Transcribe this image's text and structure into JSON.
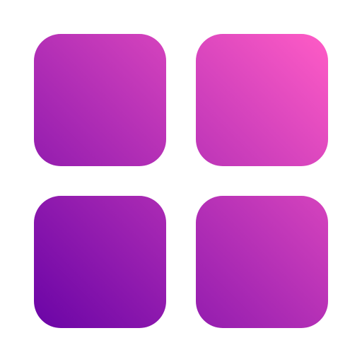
{
  "icon": {
    "name": "app-grid-icon",
    "tiles": [
      {
        "name": "tile-top-left"
      },
      {
        "name": "tile-top-right"
      },
      {
        "name": "tile-bottom-left"
      },
      {
        "name": "tile-bottom-right"
      }
    ]
  },
  "colors": {
    "gradient_start": "#6a04a6",
    "gradient_end": "#ff5cc6",
    "background": "#ffffff"
  }
}
